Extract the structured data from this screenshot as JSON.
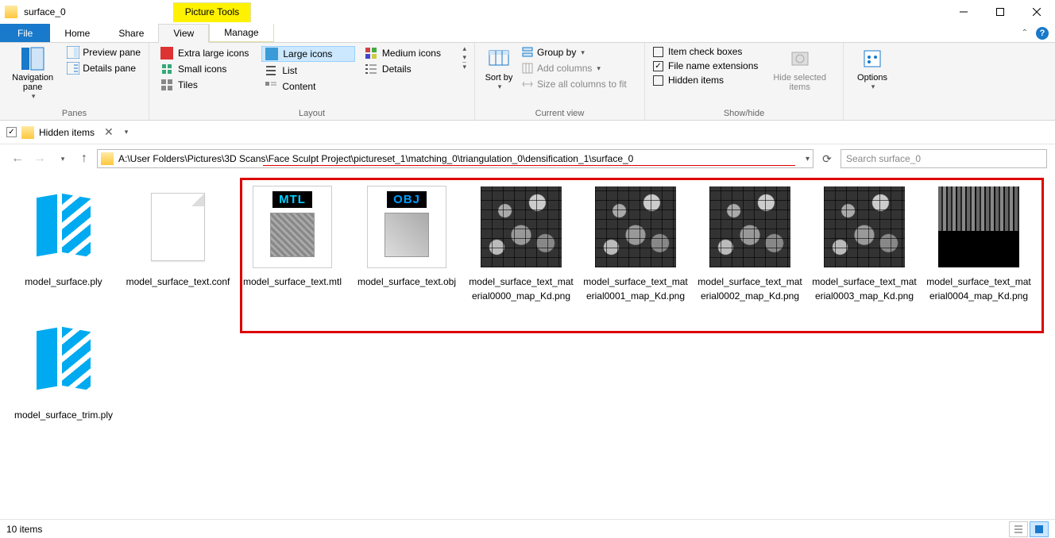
{
  "window": {
    "title": "surface_0",
    "pictureTools": "Picture Tools"
  },
  "tabs": {
    "file": "File",
    "home": "Home",
    "share": "Share",
    "view": "View",
    "manage": "Manage"
  },
  "ribbon": {
    "panes": {
      "navigation": "Navigation pane",
      "preview": "Preview pane",
      "details": "Details pane",
      "label": "Panes"
    },
    "layout": {
      "xlarge": "Extra large icons",
      "large": "Large icons",
      "medium": "Medium icons",
      "small": "Small icons",
      "list": "List",
      "details": "Details",
      "tiles": "Tiles",
      "content": "Content",
      "label": "Layout"
    },
    "currentview": {
      "sortby": "Sort by",
      "groupby": "Group by",
      "addcolumns": "Add columns",
      "sizeall": "Size all columns to fit",
      "label": "Current view"
    },
    "showhide": {
      "itemcheck": "Item check boxes",
      "filenameext": "File name extensions",
      "hiddenitems": "Hidden items",
      "hideselected": "Hide selected items",
      "label": "Show/hide"
    },
    "options": "Options"
  },
  "qat": {
    "hiddenitems": "Hidden items"
  },
  "address": {
    "path": "A:\\User Folders\\Pictures\\3D Scans\\Face Sculpt Project\\pictureset_1\\matching_0\\triangulation_0\\densification_1\\surface_0",
    "searchPlaceholder": "Search surface_0"
  },
  "files": [
    {
      "name": "model_surface.ply",
      "type": "ply"
    },
    {
      "name": "model_surface_text.conf",
      "type": "conf"
    },
    {
      "name": "model_surface_text.mtl",
      "type": "mtl"
    },
    {
      "name": "model_surface_text.obj",
      "type": "obj"
    },
    {
      "name": "model_surface_text_material0000_map_Kd.png",
      "type": "tex"
    },
    {
      "name": "model_surface_text_material0001_map_Kd.png",
      "type": "tex"
    },
    {
      "name": "model_surface_text_material0002_map_Kd.png",
      "type": "tex"
    },
    {
      "name": "model_surface_text_material0003_map_Kd.png",
      "type": "tex"
    },
    {
      "name": "model_surface_text_material0004_map_Kd.png",
      "type": "tex4"
    },
    {
      "name": "model_surface_trim.ply",
      "type": "ply"
    }
  ],
  "status": {
    "count": "10 items"
  }
}
